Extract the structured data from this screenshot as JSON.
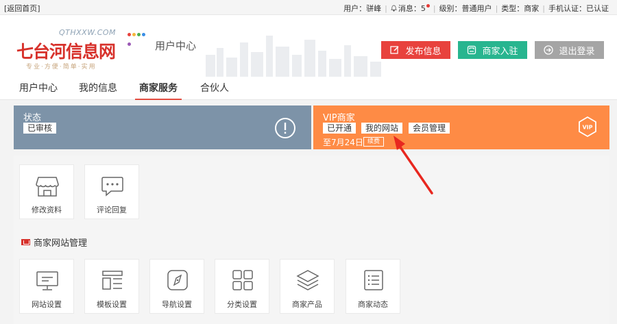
{
  "topbar": {
    "home_link": "[返回首页]",
    "user": "用户：骈峰",
    "messages": "消息：5",
    "level": "级别：普通用户",
    "type": "类型：商家",
    "phone_verify": "手机认证：已认证"
  },
  "header": {
    "logo_domain": "QTHXXW.COM",
    "logo_text": "七台河信息网",
    "logo_slogan": "专业·方便·简单·实用",
    "subtitle": "用户中心",
    "publish_label": "发布信息",
    "merchant_label": "商家入驻",
    "logout_label": "退出登录",
    "colors": {
      "publish": "#e8423d",
      "merchant": "#28b58f",
      "logout": "#a5a5a5"
    }
  },
  "nav": {
    "tabs": [
      {
        "label": "用户中心"
      },
      {
        "label": "我的信息"
      },
      {
        "label": "商家服务"
      },
      {
        "label": "合伙人"
      }
    ],
    "active_index": 2
  },
  "status_card": {
    "title": "状态",
    "value": "已审核",
    "icon": "exclamation-circle-icon",
    "color": "#7d93a8"
  },
  "vip_card": {
    "title": "VIP商家",
    "chips": [
      "已开通",
      "我的网站",
      "会员管理"
    ],
    "expiry": "至7月24日",
    "renew_label": "续费",
    "icon": "vip-hexagon-icon",
    "color": "#fe8b45"
  },
  "quick_tiles": [
    {
      "label": "修改资料",
      "icon": "shop-icon"
    },
    {
      "label": "评论回复",
      "icon": "comment-icon"
    }
  ],
  "site_section": {
    "title": "商家网站管理",
    "tiles": [
      {
        "label": "网站设置",
        "icon": "monitor-icon"
      },
      {
        "label": "模板设置",
        "icon": "template-icon"
      },
      {
        "label": "导航设置",
        "icon": "compass-icon"
      },
      {
        "label": "分类设置",
        "icon": "grid-icon"
      },
      {
        "label": "商家产品",
        "icon": "layers-icon"
      },
      {
        "label": "商家动态",
        "icon": "list-icon"
      }
    ]
  }
}
